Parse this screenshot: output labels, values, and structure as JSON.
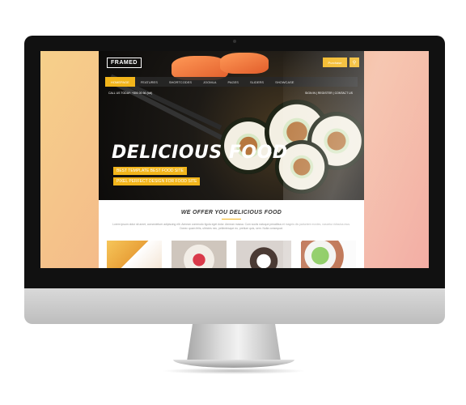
{
  "site": {
    "logo": "FRAMED",
    "contact_label": "Purchase",
    "search_icon": "search-icon",
    "nav": [
      "HOMEPAGE",
      "FEATURES",
      "SHORTCODES",
      "JOOMLA",
      "PAGES",
      "SLIDERS",
      "SHOWCASE"
    ],
    "callbar": "CALL US TODAY: +800 00 56 (toll)",
    "toplinks": "SIGN IN  |  REGISTER  |  CONTACT US",
    "hero_title": "DELICIOUS FOOD",
    "tag1": "BEST TEMPLATE BEST FOOD SITE",
    "tag2": "PIXEL PERFECT DESIGN FOR FOOD SITE",
    "section_title": "WE OFFER YOU DELICIOUS FOOD",
    "section_text": "Lorem ipsum dolor sit amet, consectetuer adipiscing elit. Aenean commodo ligula eget dolor. Aenean massa. Cum sociis natoque penatibus et magnis dis parturient montes, nascetur ridiculus mus. Donec quam felis, ultricies nec, pellentesque eu, pretium quis, sem. Nulla consequat."
  },
  "colors": {
    "accent": "#f2b51b",
    "bezel": "#111111",
    "stand": "#c8c8c8"
  }
}
